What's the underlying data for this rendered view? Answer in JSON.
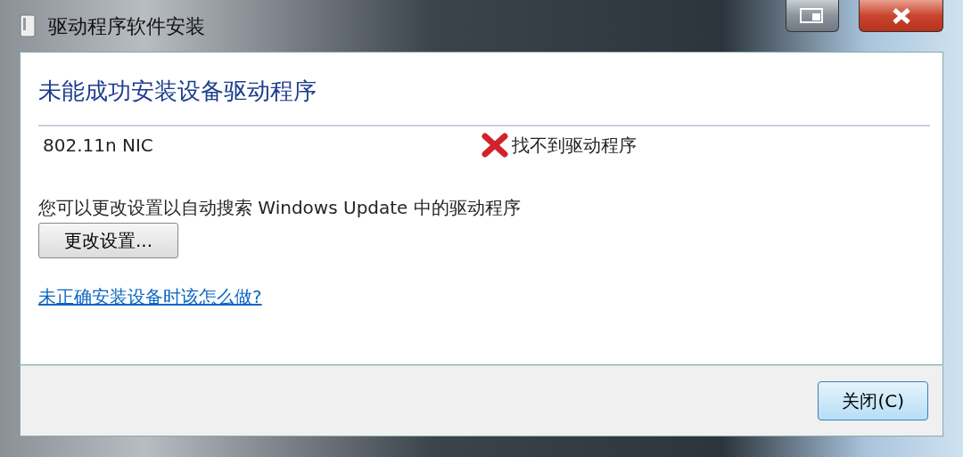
{
  "window": {
    "title": "驱动程序软件安装"
  },
  "heading": "未能成功安装设备驱动程序",
  "devices": [
    {
      "name": "802.11n NIC",
      "status": {
        "kind": "error",
        "text": "找不到驱动程序"
      }
    }
  ],
  "hint": "您可以更改设置以自动搜索 Windows Update 中的驱动程序",
  "settings_button": "更改设置...",
  "help_link": "未正确安装设备时该怎么做?",
  "footer_buttons": [
    {
      "label": "关闭(C)",
      "default": true
    }
  ]
}
